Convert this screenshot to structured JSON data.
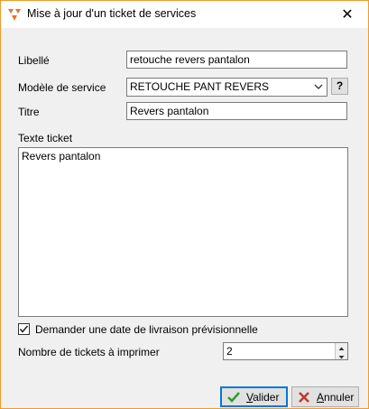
{
  "window": {
    "title": "Mise à jour d'un ticket de services",
    "close_glyph": "✕"
  },
  "form": {
    "libelle_label": "Libellé",
    "libelle_value": "retouche revers pantalon",
    "modele_label": "Modèle de service",
    "modele_value": "RETOUCHE PANT REVERS",
    "help_button": "?",
    "titre_label": "Titre",
    "titre_value": "Revers pantalon",
    "texte_label": "Texte ticket",
    "texte_value": "Revers pantalon",
    "checkbox_label": "Demander une date de livraison prévisionnelle",
    "checkbox_checked": true,
    "nb_label": "Nombre de tickets à imprimer",
    "nb_value": "2"
  },
  "buttons": {
    "valider_first": "V",
    "valider_rest": "alider",
    "annuler_first": "A",
    "annuler_rest": "nnuler"
  },
  "colors": {
    "accent": "#0078d7",
    "window_border": "#ef9a2a",
    "ok_green": "#2e9c2e",
    "cancel_red": "#c0392b"
  },
  "icons": [
    "app-logo-icon",
    "close-icon",
    "chevron-down-icon",
    "checkmark-icon",
    "spin-up-icon",
    "spin-down-icon",
    "check-icon",
    "cross-icon"
  ]
}
